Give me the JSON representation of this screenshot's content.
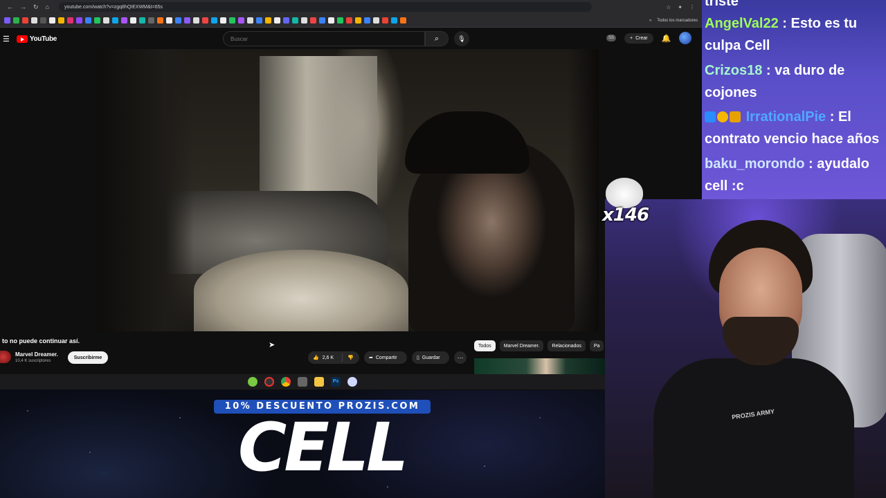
{
  "browser": {
    "url": "youtube.com/watch?v=zgq8hQIEXWM&t=65s",
    "bookmarks_label": "Todos los marcadores"
  },
  "youtube": {
    "logo_text": "YouTube",
    "search_placeholder": "Buscar",
    "cc_label": "SS",
    "create_label": "Crear"
  },
  "video": {
    "title": "to no puede continuar así.",
    "channel_name": "Marvel Dreamer.",
    "channel_subs": "10,4 K suscriptores",
    "subscribe_label": "Suscribirme",
    "likes": "2,6 K",
    "share_label": "Compartir",
    "save_label": "Guardar"
  },
  "chips": [
    "Todos",
    "Marvel Dreamer.",
    "Relacionados",
    "Pa"
  ],
  "promo": {
    "tag": "10% DESCUENTO PROZIS.COM",
    "name": "CELL"
  },
  "chat": {
    "messages": [
      {
        "user": "",
        "text": "triste"
      },
      {
        "user": "AngelVal22",
        "text": "Esto es tu culpa Cell"
      },
      {
        "user": "Crizos18",
        "text": "va duro de cojones"
      },
      {
        "user": "IrrationalPie",
        "text": "El contrato vencio hace años"
      },
      {
        "user": "baku_morondo",
        "text": "ayudalo cell :c"
      }
    ]
  },
  "overlay": {
    "emote_count": "x146",
    "shirt_text": "PROZIS ARMY"
  },
  "colors": {
    "youtube_red": "#ff0000",
    "chat_bg": "#5a4fc8",
    "promo_tag_bg": "#1f4fb8"
  }
}
